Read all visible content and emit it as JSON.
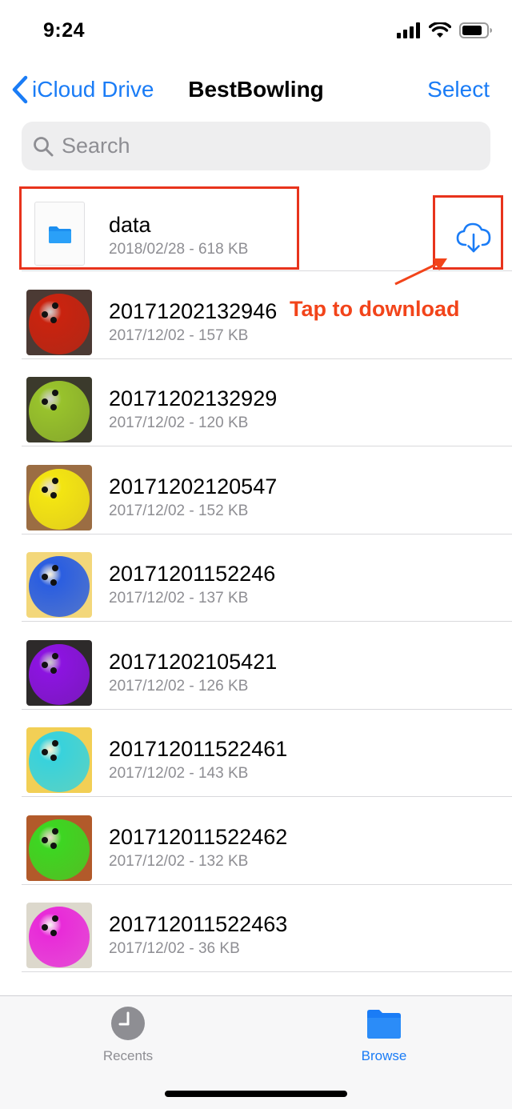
{
  "status_bar": {
    "time": "9:24"
  },
  "nav": {
    "back_label": "iCloud Drive",
    "title": "BestBowling",
    "select_label": "Select"
  },
  "search": {
    "placeholder": "Search"
  },
  "folder": {
    "name": "data",
    "meta": "2018/02/28 - 618 KB"
  },
  "annotation": {
    "text": "Tap to download"
  },
  "files": [
    {
      "name": "20171202132946",
      "meta": "2017/12/02 - 157 KB",
      "ball_color": "#c9230f",
      "bg_color": "#4b3a34"
    },
    {
      "name": "20171202132929",
      "meta": "2017/12/02 - 120 KB",
      "ball_color": "#98c22c",
      "bg_color": "#3b3a2c"
    },
    {
      "name": "20171202120547",
      "meta": "2017/12/02 - 152 KB",
      "ball_color": "#f3e512",
      "bg_color": "#9b6d43"
    },
    {
      "name": "20171201152246",
      "meta": "2017/12/02 - 137 KB",
      "ball_color": "#2b5ee0",
      "bg_color": "#f3d77a"
    },
    {
      "name": "20171202105421",
      "meta": "2017/12/02 - 126 KB",
      "ball_color": "#8c14e0",
      "bg_color": "#2d2a2a"
    },
    {
      "name": "201712011522461",
      "meta": "2017/12/02 - 143 KB",
      "ball_color": "#38d2dc",
      "bg_color": "#f2cf55"
    },
    {
      "name": "201712011522462",
      "meta": "2017/12/02 - 132 KB",
      "ball_color": "#3dd622",
      "bg_color": "#b25a2a"
    },
    {
      "name": "201712011522463",
      "meta": "2017/12/02 - 36 KB",
      "ball_color": "#e82bd8",
      "bg_color": "#dcd8cc"
    }
  ],
  "tabs": [
    {
      "label": "Recents",
      "active": false
    },
    {
      "label": "Browse",
      "active": true
    }
  ],
  "colors": {
    "accent": "#1a7cf6",
    "annotation": "#f2441a",
    "highlight": "#e8331c",
    "inactive_tab": "#8e8e93"
  }
}
